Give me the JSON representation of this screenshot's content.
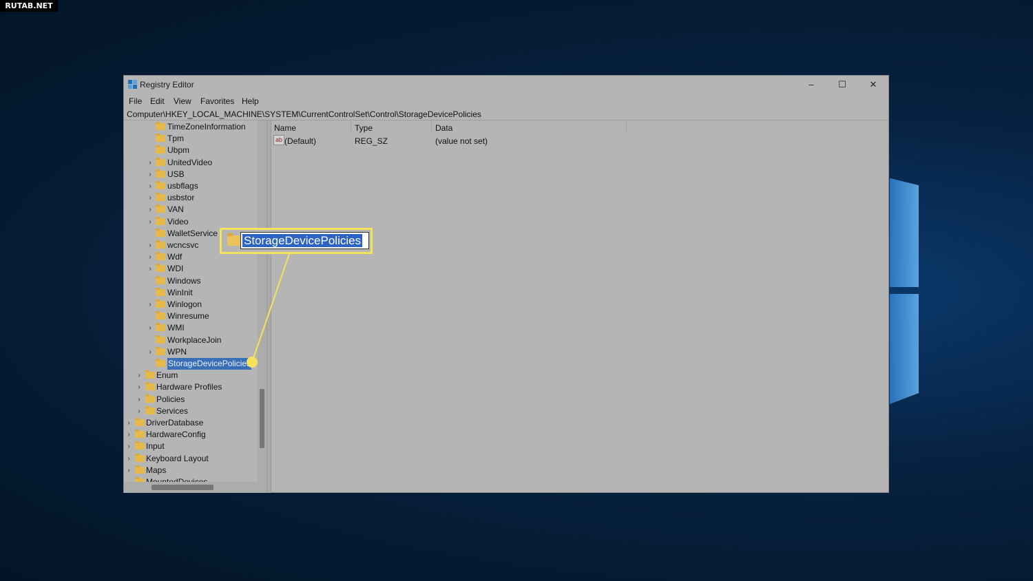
{
  "watermark": "RUTAB.NET",
  "window": {
    "title": "Registry Editor",
    "buttons": {
      "minimize": "–",
      "maximize": "☐",
      "close": "✕"
    }
  },
  "menu": [
    "File",
    "Edit",
    "View",
    "Favorites",
    "Help"
  ],
  "address": "Computer\\HKEY_LOCAL_MACHINE\\SYSTEM\\CurrentControlSet\\Control\\StorageDevicePolicies",
  "tree": [
    {
      "label": "TimeZoneInformation",
      "level": 3,
      "expandable": false
    },
    {
      "label": "Tpm",
      "level": 3,
      "expandable": false
    },
    {
      "label": "Ubpm",
      "level": 3,
      "expandable": false
    },
    {
      "label": "UnitedVideo",
      "level": 3,
      "expandable": true
    },
    {
      "label": "USB",
      "level": 3,
      "expandable": true
    },
    {
      "label": "usbflags",
      "level": 3,
      "expandable": true
    },
    {
      "label": "usbstor",
      "level": 3,
      "expandable": true
    },
    {
      "label": "VAN",
      "level": 3,
      "expandable": true
    },
    {
      "label": "Video",
      "level": 3,
      "expandable": true
    },
    {
      "label": "WalletService",
      "level": 3,
      "expandable": false
    },
    {
      "label": "wcncsvc",
      "level": 3,
      "expandable": true
    },
    {
      "label": "Wdf",
      "level": 3,
      "expandable": true
    },
    {
      "label": "WDI",
      "level": 3,
      "expandable": true
    },
    {
      "label": "Windows",
      "level": 3,
      "expandable": false
    },
    {
      "label": "WinInit",
      "level": 3,
      "expandable": false
    },
    {
      "label": "Winlogon",
      "level": 3,
      "expandable": true
    },
    {
      "label": "Winresume",
      "level": 3,
      "expandable": false
    },
    {
      "label": "WMI",
      "level": 3,
      "expandable": true
    },
    {
      "label": "WorkplaceJoin",
      "level": 3,
      "expandable": false
    },
    {
      "label": "WPN",
      "level": 3,
      "expandable": true
    },
    {
      "label": "StorageDevicePolicies",
      "level": 3,
      "expandable": false,
      "selected": true
    },
    {
      "label": "Enum",
      "level": 2,
      "expandable": true
    },
    {
      "label": "Hardware Profiles",
      "level": 2,
      "expandable": true
    },
    {
      "label": "Policies",
      "level": 2,
      "expandable": true
    },
    {
      "label": "Services",
      "level": 2,
      "expandable": true
    },
    {
      "label": "DriverDatabase",
      "level": 1,
      "expandable": true
    },
    {
      "label": "HardwareConfig",
      "level": 1,
      "expandable": true
    },
    {
      "label": "Input",
      "level": 1,
      "expandable": true
    },
    {
      "label": "Keyboard Layout",
      "level": 1,
      "expandable": true
    },
    {
      "label": "Maps",
      "level": 1,
      "expandable": true
    },
    {
      "label": "MountedDevices",
      "level": 1,
      "expandable": false
    }
  ],
  "list": {
    "columns": [
      "Name",
      "Type",
      "Data"
    ],
    "rows": [
      {
        "icon": "ab",
        "name": "(Default)",
        "type": "REG_SZ",
        "data": "(value not set)"
      }
    ]
  },
  "callout": {
    "text": "StorageDevicePolicies"
  }
}
